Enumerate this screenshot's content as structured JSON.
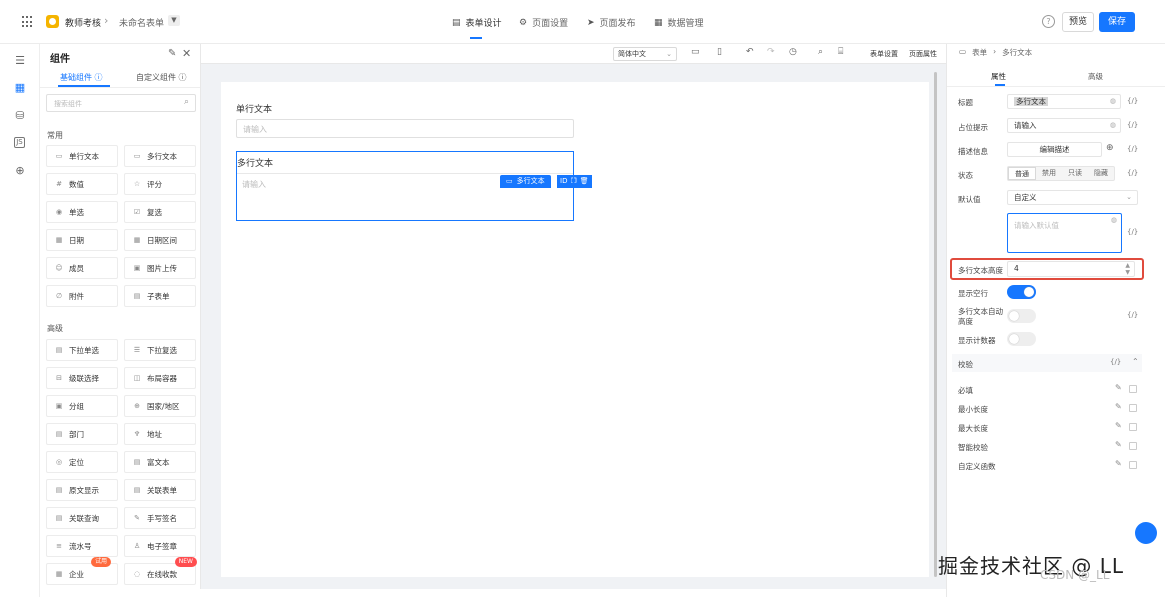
{
  "topbar": {
    "app_name": "教师考核",
    "form_name": "未命名表单",
    "tabs": [
      {
        "label": "表单设计",
        "icon": "form-icon"
      },
      {
        "label": "页面设置",
        "icon": "gear-icon"
      },
      {
        "label": "页面发布",
        "icon": "send-icon"
      },
      {
        "label": "数据管理",
        "icon": "table-icon"
      }
    ],
    "preview_label": "预览",
    "save_label": "保存"
  },
  "component_panel": {
    "title": "组件",
    "tabs": [
      "基础组件",
      "自定义组件"
    ],
    "search_placeholder": "搜索组件",
    "groups": [
      {
        "name": "常用",
        "items": [
          "单行文本",
          "多行文本",
          "数值",
          "评分",
          "单选",
          "复选",
          "日期",
          "日期区间",
          "成员",
          "图片上传",
          "附件",
          "子表单"
        ]
      },
      {
        "name": "高级",
        "items": [
          "下拉单选",
          "下拉复选",
          "级联选择",
          "布局容器",
          "分组",
          "国家/地区",
          "部门",
          "地址",
          "定位",
          "富文本",
          "原文显示",
          "关联表单",
          "关联查询",
          "手写签名",
          "流水号",
          "电子签章",
          "企业",
          "在线收款"
        ]
      }
    ],
    "badges": {
      "try": "试用",
      "new": "NEW"
    }
  },
  "toolbar": {
    "language": "简体中文",
    "form_settings": "表单设置",
    "page_properties": "页面属性"
  },
  "canvas": {
    "field1": {
      "label": "单行文本",
      "placeholder": "请输入"
    },
    "field2": {
      "label": "多行文本",
      "placeholder": "请输入"
    },
    "selected_tag": "多行文本"
  },
  "props": {
    "breadcrumb": [
      "表单",
      "多行文本"
    ],
    "tabs": [
      "属性",
      "高级"
    ],
    "title_label": "标题",
    "title_value": "多行文本",
    "placeholder_label": "占位提示",
    "placeholder_value": "请输入",
    "desc_label": "描述信息",
    "desc_button": "编辑描述",
    "state_label": "状态",
    "state_options": [
      "普通",
      "禁用",
      "只读",
      "隐藏"
    ],
    "default_label": "默认值",
    "default_select": "自定义",
    "default_placeholder": "请输入默认值",
    "height_label": "多行文本高度",
    "height_value": "4",
    "show_empty_label": "显示空行",
    "auto_height_label": "多行文本自动高度",
    "show_count_label": "显示计数器",
    "validation_label": "校验",
    "validation_items": [
      "必填",
      "最小长度",
      "最大长度",
      "智能校验",
      "自定义函数"
    ],
    "fx": "{/}"
  },
  "watermark": "掘金技术社区 @ LL",
  "watermark_sub": "CSDN @_LL"
}
